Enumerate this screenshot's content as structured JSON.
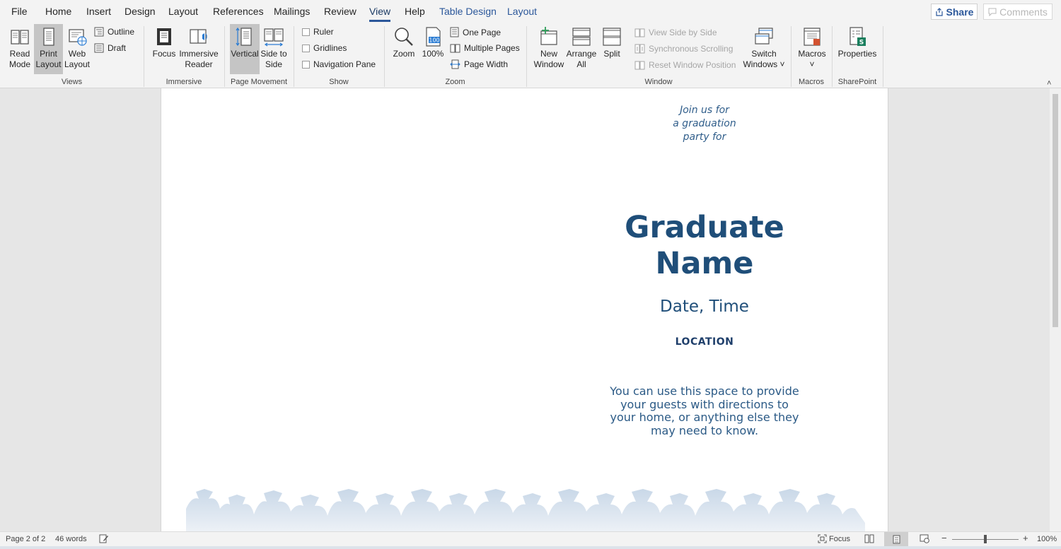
{
  "tabs": [
    "File",
    "Home",
    "Insert",
    "Design",
    "Layout",
    "References",
    "Mailings",
    "Review",
    "View",
    "Help",
    "Table Design",
    "Layout"
  ],
  "active_tab": "View",
  "share_label": "Share",
  "comments_label": "Comments",
  "ribbon": {
    "views": {
      "group": "Views",
      "read_mode": "Read Mode",
      "print_layout": "Print Layout",
      "web_layout": "Web Layout",
      "outline": "Outline",
      "draft": "Draft"
    },
    "immersive": {
      "group": "Immersive",
      "focus": "Focus",
      "immersive_reader": "Immersive Reader"
    },
    "page_movement": {
      "group": "Page Movement",
      "vertical": "Vertical",
      "side_to_side": "Side to Side"
    },
    "show": {
      "group": "Show",
      "ruler": "Ruler",
      "gridlines": "Gridlines",
      "navigation_pane": "Navigation Pane"
    },
    "zoom": {
      "group": "Zoom",
      "zoom": "Zoom",
      "hundred": "100%",
      "one_page": "One Page",
      "multiple_pages": "Multiple Pages",
      "page_width": "Page Width"
    },
    "window": {
      "group": "Window",
      "new_window": "New Window",
      "arrange_all": "Arrange All",
      "split": "Split",
      "view_side_by_side": "View Side by Side",
      "synchronous_scrolling": "Synchronous Scrolling",
      "reset_window_position": "Reset Window Position",
      "switch_windows": "Switch Windows"
    },
    "macros": {
      "group": "Macros",
      "macros": "Macros"
    },
    "sharepoint": {
      "group": "SharePoint",
      "properties": "Properties"
    }
  },
  "document": {
    "intro": [
      "Join us for",
      "a graduation",
      "party for"
    ],
    "name": [
      "Graduate",
      "Name"
    ],
    "date_time": "Date, Time",
    "location": "LOCATION",
    "note": [
      "You can use this space to provide",
      "your guests with directions to",
      "your home, or anything else they",
      "may need to know."
    ]
  },
  "status": {
    "page": "Page 2 of 2",
    "words": "46 words",
    "focus": "Focus",
    "zoom": "100%"
  },
  "colors": {
    "accent": "#2b579a",
    "invite_text": "#1f4e79"
  }
}
